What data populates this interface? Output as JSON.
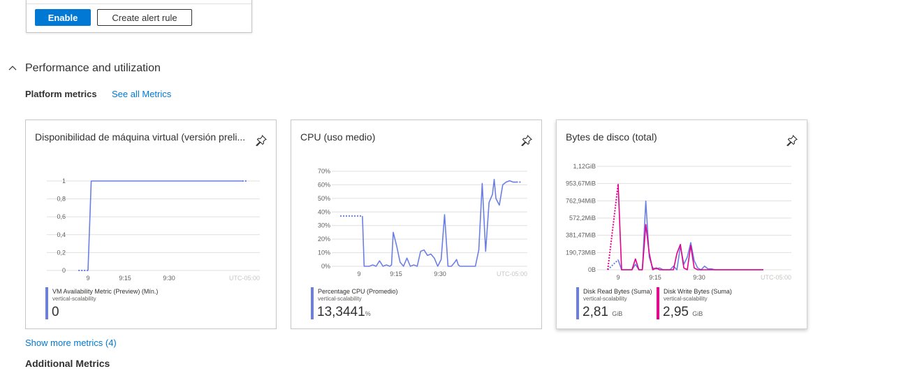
{
  "top_card": {
    "enable_label": "Enable",
    "create_alert_label": "Create alert rule"
  },
  "section": {
    "title": "Performance and utilization",
    "platform_metrics_label": "Platform metrics",
    "see_all_link": "See all Metrics"
  },
  "show_more": "Show more metrics (4)",
  "cut_off_heading": "Additional Metrics",
  "colors": {
    "primary": "#0078d4",
    "series_blue": "#6b7fe3",
    "series_magenta": "#e3008c",
    "grid": "#e1dfdd"
  },
  "chart_data": [
    {
      "type": "line",
      "title": "Disponibilidad de máquina virtual (versión preli...",
      "yticks": [
        "1",
        "0,8",
        "0,6",
        "0,4",
        "0,2",
        "0"
      ],
      "ylim": [
        0,
        1
      ],
      "xticks": [
        "9",
        "9:15",
        "9:30"
      ],
      "timezone": "UTC-05:00",
      "series": [
        {
          "name": "VM Availability Metric (Preview) (Mín.)",
          "resource": "vertical-scalability",
          "summary": "0",
          "unit": "",
          "dashed": [
            [
              -3,
              0
            ],
            [
              0,
              0
            ]
          ],
          "x": [
            0,
            1,
            2,
            4,
            8,
            12,
            16,
            20,
            24,
            28,
            32,
            36,
            40,
            44,
            48
          ],
          "y": [
            0,
            1,
            1,
            1,
            1,
            1,
            1,
            1,
            1,
            1,
            1,
            1,
            1,
            1,
            1
          ]
        }
      ]
    },
    {
      "type": "line",
      "title": "CPU (uso medio)",
      "yticks": [
        "70%",
        "60%",
        "50%",
        "40%",
        "30%",
        "20%",
        "10%",
        "0%"
      ],
      "ylim": [
        0,
        70
      ],
      "xticks": [
        "9",
        "9:15",
        "9:30"
      ],
      "timezone": "UTC-05:00",
      "series": [
        {
          "name": "Percentage CPU (Promedio)",
          "resource": "vertical-scalability",
          "summary": "13,3441",
          "unit": "%",
          "dashed": [
            [
              -5.5,
              37
            ],
            [
              1,
              37
            ]
          ],
          "x": [
            1,
            1.5,
            3,
            4,
            5,
            5.5,
            6,
            7,
            8,
            9,
            9.5,
            10,
            11,
            12,
            13,
            14,
            15,
            16,
            17,
            18,
            19,
            20,
            21,
            22,
            23,
            24,
            25,
            26,
            27,
            28,
            28.5,
            29,
            29.5,
            30,
            31,
            32,
            33,
            34,
            35,
            36,
            37,
            38,
            39,
            39.5,
            40,
            41,
            42,
            43,
            44,
            45,
            46
          ],
          "y": [
            37,
            0,
            0,
            1,
            0,
            2,
            4,
            0,
            1,
            0,
            1,
            25,
            15,
            3,
            0,
            6,
            0,
            1,
            0,
            11,
            12,
            8,
            9,
            6,
            0,
            5,
            38,
            0,
            0,
            3,
            5,
            1,
            0,
            0,
            0,
            0,
            0,
            0,
            12,
            61,
            11,
            47,
            53,
            64,
            50,
            45,
            60,
            62,
            63,
            62,
            62
          ]
        }
      ]
    },
    {
      "type": "line",
      "title": "Bytes de disco (total)",
      "yticks": [
        "1,12GiB",
        "953,67MiB",
        "762,94MiB",
        "572,2MiB",
        "381,47MiB",
        "190,73MiB",
        "0B"
      ],
      "ylim": [
        0,
        1144
      ],
      "xticks": [
        "9",
        "9:15",
        "9:30"
      ],
      "timezone": "UTC-05:00",
      "series": [
        {
          "name": "Disk Read Bytes (Suma)",
          "resource": "vertical-scalability",
          "summary": "2,81",
          "unit": "GiB",
          "color": "#6b7fe3",
          "dashed": [
            [
              -3,
              0
            ],
            [
              0,
              110
            ]
          ],
          "x": [
            0,
            1,
            2,
            3,
            4,
            5,
            6,
            7,
            8,
            9,
            10,
            11,
            12,
            13,
            14,
            15,
            16,
            17,
            18,
            19,
            20,
            21,
            22,
            23,
            24,
            25,
            26,
            27,
            28,
            29,
            30,
            31,
            32,
            33,
            34,
            35,
            36,
            37,
            38,
            39,
            40,
            41,
            42
          ],
          "y": [
            110,
            0,
            0,
            0,
            0,
            60,
            0,
            0,
            760,
            140,
            20,
            10,
            20,
            0,
            0,
            0,
            40,
            0,
            260,
            60,
            140,
            300,
            100,
            20,
            0,
            40,
            10,
            10,
            0,
            0,
            0,
            0,
            0,
            0,
            0,
            0,
            0,
            0,
            0,
            0,
            0,
            0,
            0
          ]
        },
        {
          "name": "Disk Write Bytes (Suma)",
          "resource": "vertical-scalability",
          "summary": "2,95",
          "unit": "GiB",
          "color": "#e3008c",
          "dashed": [
            [
              -3,
              0
            ],
            [
              0,
              950
            ]
          ],
          "x": [
            0,
            1,
            2,
            3,
            4,
            5,
            6,
            7,
            8,
            9,
            10,
            11,
            12,
            13,
            14,
            15,
            16,
            17,
            18,
            19,
            20,
            21,
            22,
            23,
            24,
            25,
            26,
            27,
            28,
            29,
            30,
            31,
            32,
            33,
            34,
            35,
            36,
            37,
            38,
            39,
            40,
            41,
            42
          ],
          "y": [
            950,
            0,
            0,
            0,
            0,
            120,
            0,
            0,
            500,
            180,
            0,
            20,
            0,
            0,
            0,
            0,
            0,
            180,
            280,
            20,
            0,
            270,
            20,
            0,
            0,
            0,
            0,
            0,
            0,
            0,
            0,
            0,
            0,
            0,
            0,
            0,
            0,
            0,
            0,
            0,
            0,
            0,
            0
          ]
        }
      ]
    }
  ]
}
